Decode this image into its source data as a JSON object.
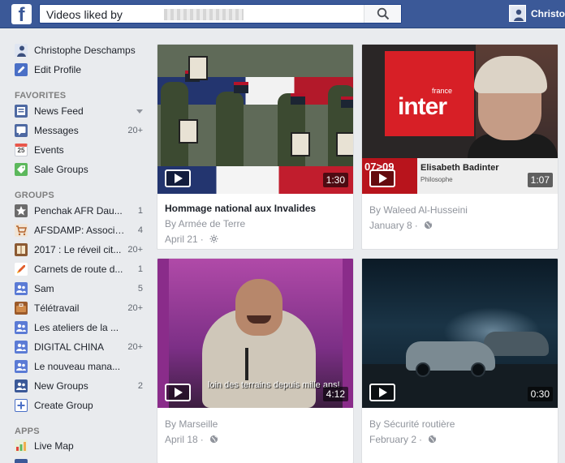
{
  "topbar": {
    "logo": "f",
    "search_value": "Videos liked by",
    "profile_name": "Christo"
  },
  "sidebar": {
    "user_name": "Christophe Deschamps",
    "edit_profile": "Edit Profile",
    "favorites_header": "FAVORITES",
    "favorites": [
      {
        "label": "News Feed",
        "count": "",
        "icon": "news-feed-icon"
      },
      {
        "label": "Messages",
        "count": "20+",
        "icon": "messages-icon"
      },
      {
        "label": "Events",
        "count": "",
        "icon": "events-icon",
        "icon_text": "25"
      },
      {
        "label": "Sale Groups",
        "count": "",
        "icon": "sale-groups-icon"
      }
    ],
    "groups_header": "GROUPS",
    "groups": [
      {
        "label": "Penchak AFR Dau...",
        "count": "1",
        "icon": "star-icon"
      },
      {
        "label": "AFSDAMP: Associat...",
        "count": "4",
        "icon": "cart-icon"
      },
      {
        "label": "2017 : Le réveil cit...",
        "count": "20+",
        "icon": "book-icon"
      },
      {
        "label": "Carnets de route d...",
        "count": "1",
        "icon": "rocket-icon"
      },
      {
        "label": "Sam",
        "count": "5",
        "icon": "group-icon"
      },
      {
        "label": "Télétravail",
        "count": "20+",
        "icon": "briefcase-icon"
      },
      {
        "label": "Les ateliers de la ...",
        "count": "",
        "icon": "group-icon"
      },
      {
        "label": "DIGITAL CHINA",
        "count": "20+",
        "icon": "group-icon"
      },
      {
        "label": "Le nouveau mana...",
        "count": "",
        "icon": "group-icon"
      },
      {
        "label": "New Groups",
        "count": "2",
        "icon": "new-groups-icon"
      },
      {
        "label": "Create Group",
        "count": "",
        "icon": "create-group-icon"
      }
    ],
    "apps_header": "APPS",
    "apps": [
      {
        "label": "Live Map",
        "count": "",
        "icon": "live-map-icon"
      }
    ]
  },
  "videos": [
    {
      "title": "Hommage national aux Invalides",
      "author": "By Armée de Terre",
      "date": "April 21",
      "duration": "1:30",
      "privacy": "public-gear-icon"
    },
    {
      "title": "",
      "author": "By Waleed Al-Husseini",
      "date": "January 8",
      "duration": "1:07",
      "privacy": "globe-icon"
    },
    {
      "title": "",
      "author": "By Marseille",
      "date": "April 18",
      "duration": "4:12",
      "privacy": "globe-icon"
    },
    {
      "title": "",
      "author": "By Sécurité routière",
      "date": "February 2",
      "duration": "0:30",
      "privacy": "globe-icon"
    }
  ],
  "thumb_text": {
    "inter_brand": "inter",
    "inter_small": "france",
    "lt_time": "07>09",
    "lt_name": "Elisabeth Badinter",
    "lt_sub": "Philosophe",
    "subtitle": "loin des terrains depuis mille ans!"
  },
  "colors": {
    "brand_blue": "#3b5998",
    "background": "#e9ebee"
  }
}
